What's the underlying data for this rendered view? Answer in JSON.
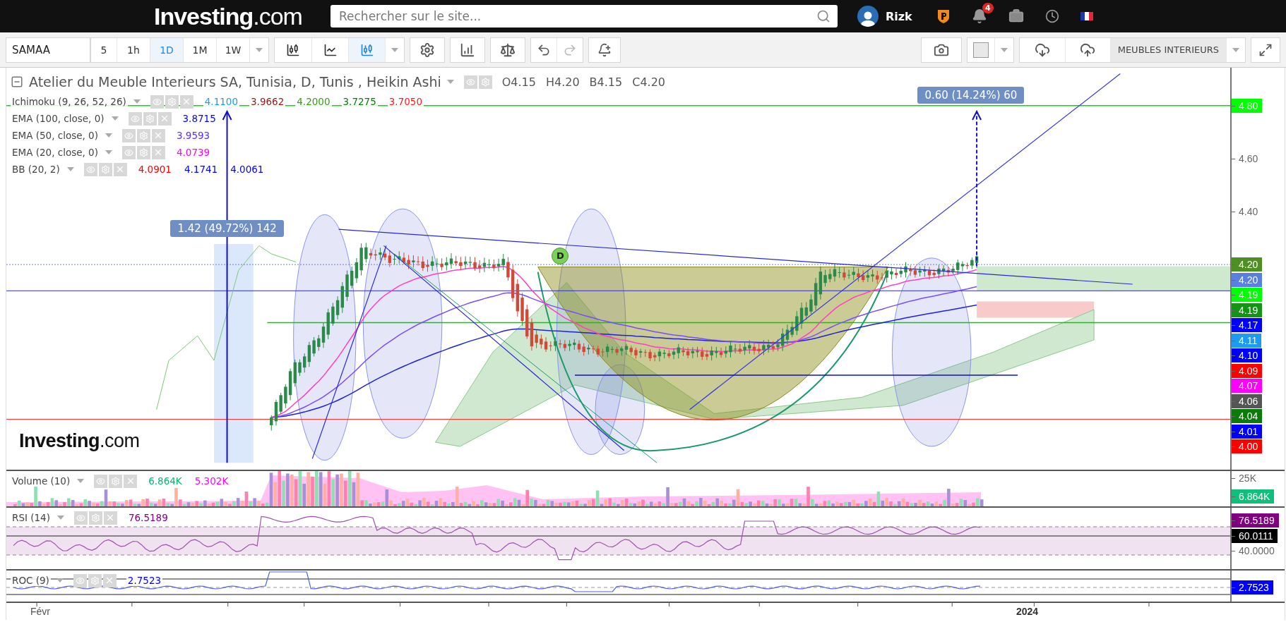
{
  "top_bar": {
    "logo": "**Investing**.com",
    "search": {
      "placeholder": "Rechercher sur le site..."
    },
    "user": "Rizk",
    "notifications": "4"
  },
  "toolbar": {
    "symbol": "SAMAA",
    "intervals": [
      {
        "label": "5",
        "selected": false
      },
      {
        "label": "1h",
        "selected": false
      },
      {
        "label": "1D",
        "selected": true
      },
      {
        "label": "1M",
        "selected": false
      },
      {
        "label": "1W",
        "selected": false
      }
    ],
    "chart_types": [
      {
        "kind": "bars",
        "selected": false
      },
      {
        "kind": "line",
        "selected": false
      },
      {
        "kind": "candles",
        "selected": true
      }
    ],
    "redo_disabled": true,
    "category": "MEUBLES INTERIEURS"
  },
  "main_panel": {
    "title": "Atelier du Meuble Interieurs SA, Tunisia, D, Tunis , Heikin Ashi",
    "ohlc": [
      "O4.15",
      "H4.20",
      "B4.15",
      "C4.20"
    ],
    "indicators": [
      {
        "name": "Ichimoku (9, 26, 52, 26)",
        "values": [
          {
            "text": "4.1100",
            "color": "#1e9bf0"
          },
          {
            "text": "3.9662",
            "color": "#8b1a1a"
          },
          {
            "text": "4.2000",
            "color": "#3c9a1c"
          },
          {
            "text": "3.7275",
            "color": "#0a7a0a"
          },
          {
            "text": "3.7050",
            "color": "#ff1a1a"
          }
        ]
      },
      {
        "name": "EMA (100, close, 0)",
        "values": [
          {
            "text": "3.8715",
            "color": "#0000ff"
          }
        ]
      },
      {
        "name": "EMA (50, close, 0)",
        "values": [
          {
            "text": "3.9593",
            "color": "#5b2cff"
          }
        ]
      },
      {
        "name": "EMA (20, close, 0)",
        "values": [
          {
            "text": "4.0739",
            "color": "#ff00ff"
          }
        ]
      },
      {
        "name": "BB (20, 2)",
        "values": [
          {
            "text": "4.0901",
            "color": "#ff0000"
          },
          {
            "text": "4.1741",
            "color": "#0000ff"
          },
          {
            "text": "4.0061",
            "color": "#0000ff"
          }
        ]
      }
    ],
    "measures": [
      "1.42 (49.72%) 142",
      "0.60 (14.24%) 60"
    ],
    "marker": "D",
    "logo": "**Investing**.com",
    "axis": [
      {
        "kind": "tick",
        "text": "4.80",
        "color": "#00ff00"
      },
      {
        "kind": "tick",
        "text": "4.60"
      },
      {
        "kind": "tick",
        "text": "4.40"
      },
      {
        "kind": "tag",
        "text": "4.20",
        "color": "#4e8f23"
      },
      {
        "kind": "tag",
        "text": "4.20",
        "color": "#5b7fe0"
      },
      {
        "kind": "tag",
        "text": "4.19",
        "color": "#00ff00"
      },
      {
        "kind": "tag",
        "text": "4.19",
        "color": "#149414"
      },
      {
        "kind": "tag",
        "text": "4.17",
        "color": "#0000ff"
      },
      {
        "kind": "tag",
        "text": "4.11",
        "color": "#1e9bf0"
      },
      {
        "kind": "tag",
        "text": "4.10",
        "color": "#0000ff"
      },
      {
        "kind": "tag",
        "text": "4.09",
        "color": "#ff0000"
      },
      {
        "kind": "tag",
        "text": "4.07",
        "color": "#ff00ff"
      },
      {
        "kind": "tag",
        "text": "4.06",
        "color": "#555555"
      },
      {
        "kind": "tag",
        "text": "4.04",
        "color": "#0a7a0a"
      },
      {
        "kind": "tag",
        "text": "4.01",
        "color": "#0000ff"
      },
      {
        "kind": "tag",
        "text": "4.00",
        "color": "#ff0000"
      }
    ]
  },
  "volume_panel": {
    "name": "Volume (10)",
    "values": [
      {
        "text": "6.864K",
        "color": "#00b86b"
      },
      {
        "text": "5.302K",
        "color": "#ff00ff"
      }
    ],
    "axis": [
      {
        "kind": "tick",
        "text": "25K"
      },
      {
        "kind": "tag",
        "text": "6.864K",
        "color": "#10c07a"
      }
    ]
  },
  "rsi_panel": {
    "name": "RSI (14)",
    "values": [
      {
        "text": "76.5189",
        "color": "#800080"
      }
    ],
    "axis": [
      {
        "kind": "tag",
        "text": "76.5189",
        "color": "#800080"
      },
      {
        "kind": "tag",
        "text": "60.0111",
        "color": "#000000"
      },
      {
        "kind": "tick",
        "text": "40.0000"
      }
    ]
  },
  "roc_panel": {
    "name": "ROC (9)",
    "values": [
      {
        "text": "2.7523",
        "color": "#0000ff"
      }
    ],
    "axis": [
      {
        "kind": "tag",
        "text": "2.7523",
        "color": "#0000ff"
      }
    ]
  },
  "time_axis": [
    "Févr",
    "2024"
  ]
}
